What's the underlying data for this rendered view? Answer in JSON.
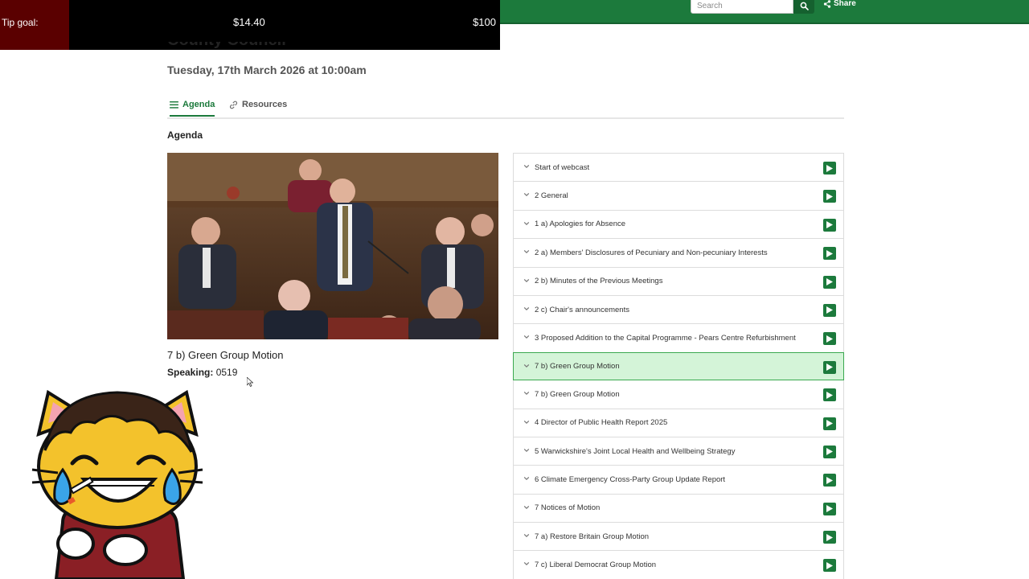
{
  "header": {
    "search_placeholder": "Search",
    "share_label": "Share",
    "colors": {
      "brand_green": "#1c7a3c",
      "active_row": "#d4f4d8"
    }
  },
  "tip_goal": {
    "label": "Tip goal:",
    "current": "$14.40",
    "target": "$100"
  },
  "meeting": {
    "title": "County Council",
    "date": "Tuesday, 17th March 2026 at 10:00am"
  },
  "tabs": [
    {
      "label": "Agenda",
      "icon": "list-icon",
      "active": true
    },
    {
      "label": "Resources",
      "icon": "link-icon",
      "active": false
    }
  ],
  "section_heading": "Agenda",
  "now_playing": {
    "title": "7 b) Green Group Motion",
    "speaking_label": "Speaking:",
    "speaking_value": "0519"
  },
  "agenda_items": [
    {
      "label": "Start of webcast",
      "active": false
    },
    {
      "label": "2 General",
      "active": false
    },
    {
      "label": "1 a) Apologies for Absence",
      "active": false
    },
    {
      "label": "2 a) Members' Disclosures of Pecuniary and Non-pecuniary Interests",
      "active": false
    },
    {
      "label": "2 b) Minutes of the Previous Meetings",
      "active": false
    },
    {
      "label": "2 c) Chair's announcements",
      "active": false
    },
    {
      "label": "3 Proposed Addition to the Capital Programme - Pears Centre Refurbishment",
      "active": false
    },
    {
      "label": "7 b) Green Group Motion",
      "active": true
    },
    {
      "label": "7 b) Green Group Motion",
      "active": false
    },
    {
      "label": "4 Director of Public Health Report 2025",
      "active": false
    },
    {
      "label": "5 Warwickshire's Joint Local Health and Wellbeing Strategy",
      "active": false
    },
    {
      "label": "6 Climate Emergency Cross-Party Group Update Report",
      "active": false
    },
    {
      "label": "7 Notices of Motion",
      "active": false
    },
    {
      "label": "7 a) Restore Britain Group Motion",
      "active": false
    },
    {
      "label": "7 c) Liberal Democrat Group Motion",
      "active": false
    }
  ]
}
